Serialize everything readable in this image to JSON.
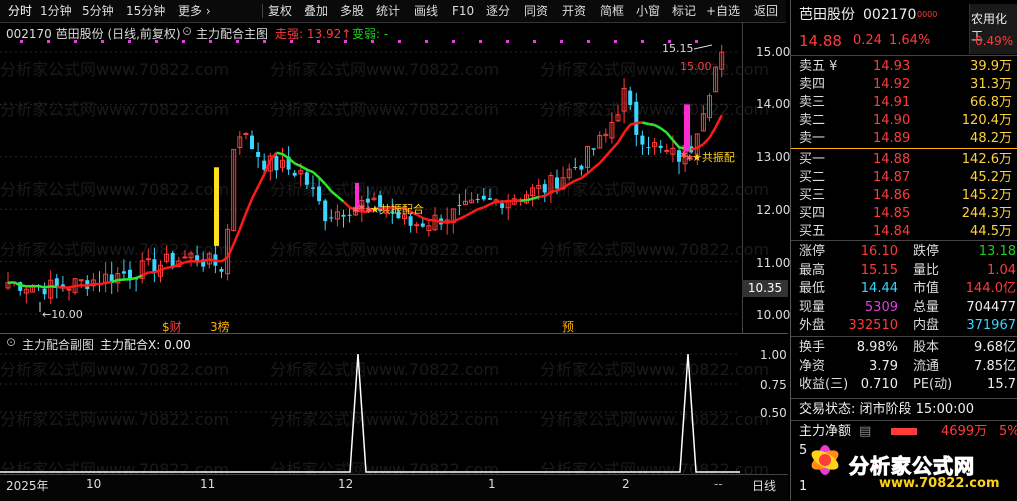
{
  "toolbar": {
    "left": [
      "分时",
      "1分钟",
      "5分钟",
      "15分钟",
      "更多 ›"
    ],
    "right": [
      "复权",
      "叠加",
      "多股",
      "统计",
      "画线",
      "F10",
      "逐分",
      "同资",
      "开资",
      "简框",
      "小窗",
      "标记",
      "+自选",
      "返回"
    ]
  },
  "main_chart": {
    "title": "002170  芭田股份 (日线,前复权)",
    "indicator": "主力配合主图",
    "strong_label": "走强: 13.92↑",
    "weak_label": "变弱: -",
    "high_label": "15.15",
    "high_price_label": "15.00",
    "low_label": "10.00",
    "resonance_label1": "共振配合",
    "resonance_label2": "共振配",
    "marker_cai": "财",
    "marker_bang": "榜",
    "marker_yu": "预",
    "cursor_price": "10.35",
    "y_ticks": [
      "15.00",
      "14.00",
      "13.00",
      "12.00",
      "11.00",
      "10.00"
    ]
  },
  "sub_chart": {
    "title": "主力配合副图",
    "value_label": "主力配合X: 0.00",
    "y_ticks": [
      "1.00",
      "0.75",
      "0.50"
    ]
  },
  "time_axis": [
    "2025年",
    "10",
    "11",
    "12",
    "1",
    "2",
    "--"
  ],
  "period_label": "日线",
  "quote": {
    "name": "芭田股份",
    "code": "002170",
    "price": "14.88",
    "change": "0.24",
    "pct": "1.64%",
    "sector": "农用化工",
    "sector_pct": "0.49%",
    "asks": [
      {
        "label": "卖五 ¥",
        "price": "14.93",
        "vol": "39.9万"
      },
      {
        "label": "卖四",
        "price": "14.92",
        "vol": "31.3万"
      },
      {
        "label": "卖三",
        "price": "14.91",
        "vol": "66.8万"
      },
      {
        "label": "卖二",
        "price": "14.90",
        "vol": "120.4万"
      },
      {
        "label": "卖一",
        "price": "14.89",
        "vol": "48.2万"
      }
    ],
    "bids": [
      {
        "label": "买一",
        "price": "14.88",
        "vol": "142.6万"
      },
      {
        "label": "买二",
        "price": "14.87",
        "vol": "45.2万"
      },
      {
        "label": "买三",
        "price": "14.86",
        "vol": "145.2万"
      },
      {
        "label": "买四",
        "price": "14.85",
        "vol": "244.3万"
      },
      {
        "label": "买五",
        "price": "14.84",
        "vol": "44.5万"
      }
    ],
    "stats1": [
      {
        "l1": "涨停",
        "v1": "16.10",
        "l2": "跌停",
        "v2": "13.18"
      },
      {
        "l1": "最高",
        "v1": "15.15",
        "l2": "量比",
        "v2": "1.04"
      },
      {
        "l1": "最低",
        "v1": "14.44",
        "l2": "市值",
        "v2": "144.0亿"
      },
      {
        "l1": "现量",
        "v1": "5309",
        "l2": "总量",
        "v2": "704477"
      },
      {
        "l1": "外盘",
        "v1": "332510",
        "l2": "内盘",
        "v2": "371967"
      }
    ],
    "stats2": [
      {
        "l1": "换手",
        "v1": "8.98%",
        "l2": "股本",
        "v2": "9.68亿"
      },
      {
        "l1": "净资",
        "v1": "3.79",
        "l2": "流通",
        "v2": "7.85亿"
      },
      {
        "l1": "收益(三)",
        "v1": "0.710",
        "l2": "PE(动)",
        "v2": "15.7"
      }
    ],
    "status": "交易状态: 闭市阶段 15:00:00",
    "main_net_label": "主力净额",
    "main_net_value": "4699万",
    "main_net_pct": "5%",
    "footer_num": "5",
    "footer_num2": "1"
  },
  "watermark": "分析家公式网www.70822.com",
  "brand": {
    "text": "分析家公式网",
    "url": "www.70822.com"
  },
  "colors": {
    "up": "#ff3b3b",
    "down": "#3ad6ff",
    "ma_red": "#ff1a1a",
    "ma_green": "#2ee62e",
    "signal_mag": "#ff2bd0",
    "signal_yellow": "#ffe11a"
  }
}
